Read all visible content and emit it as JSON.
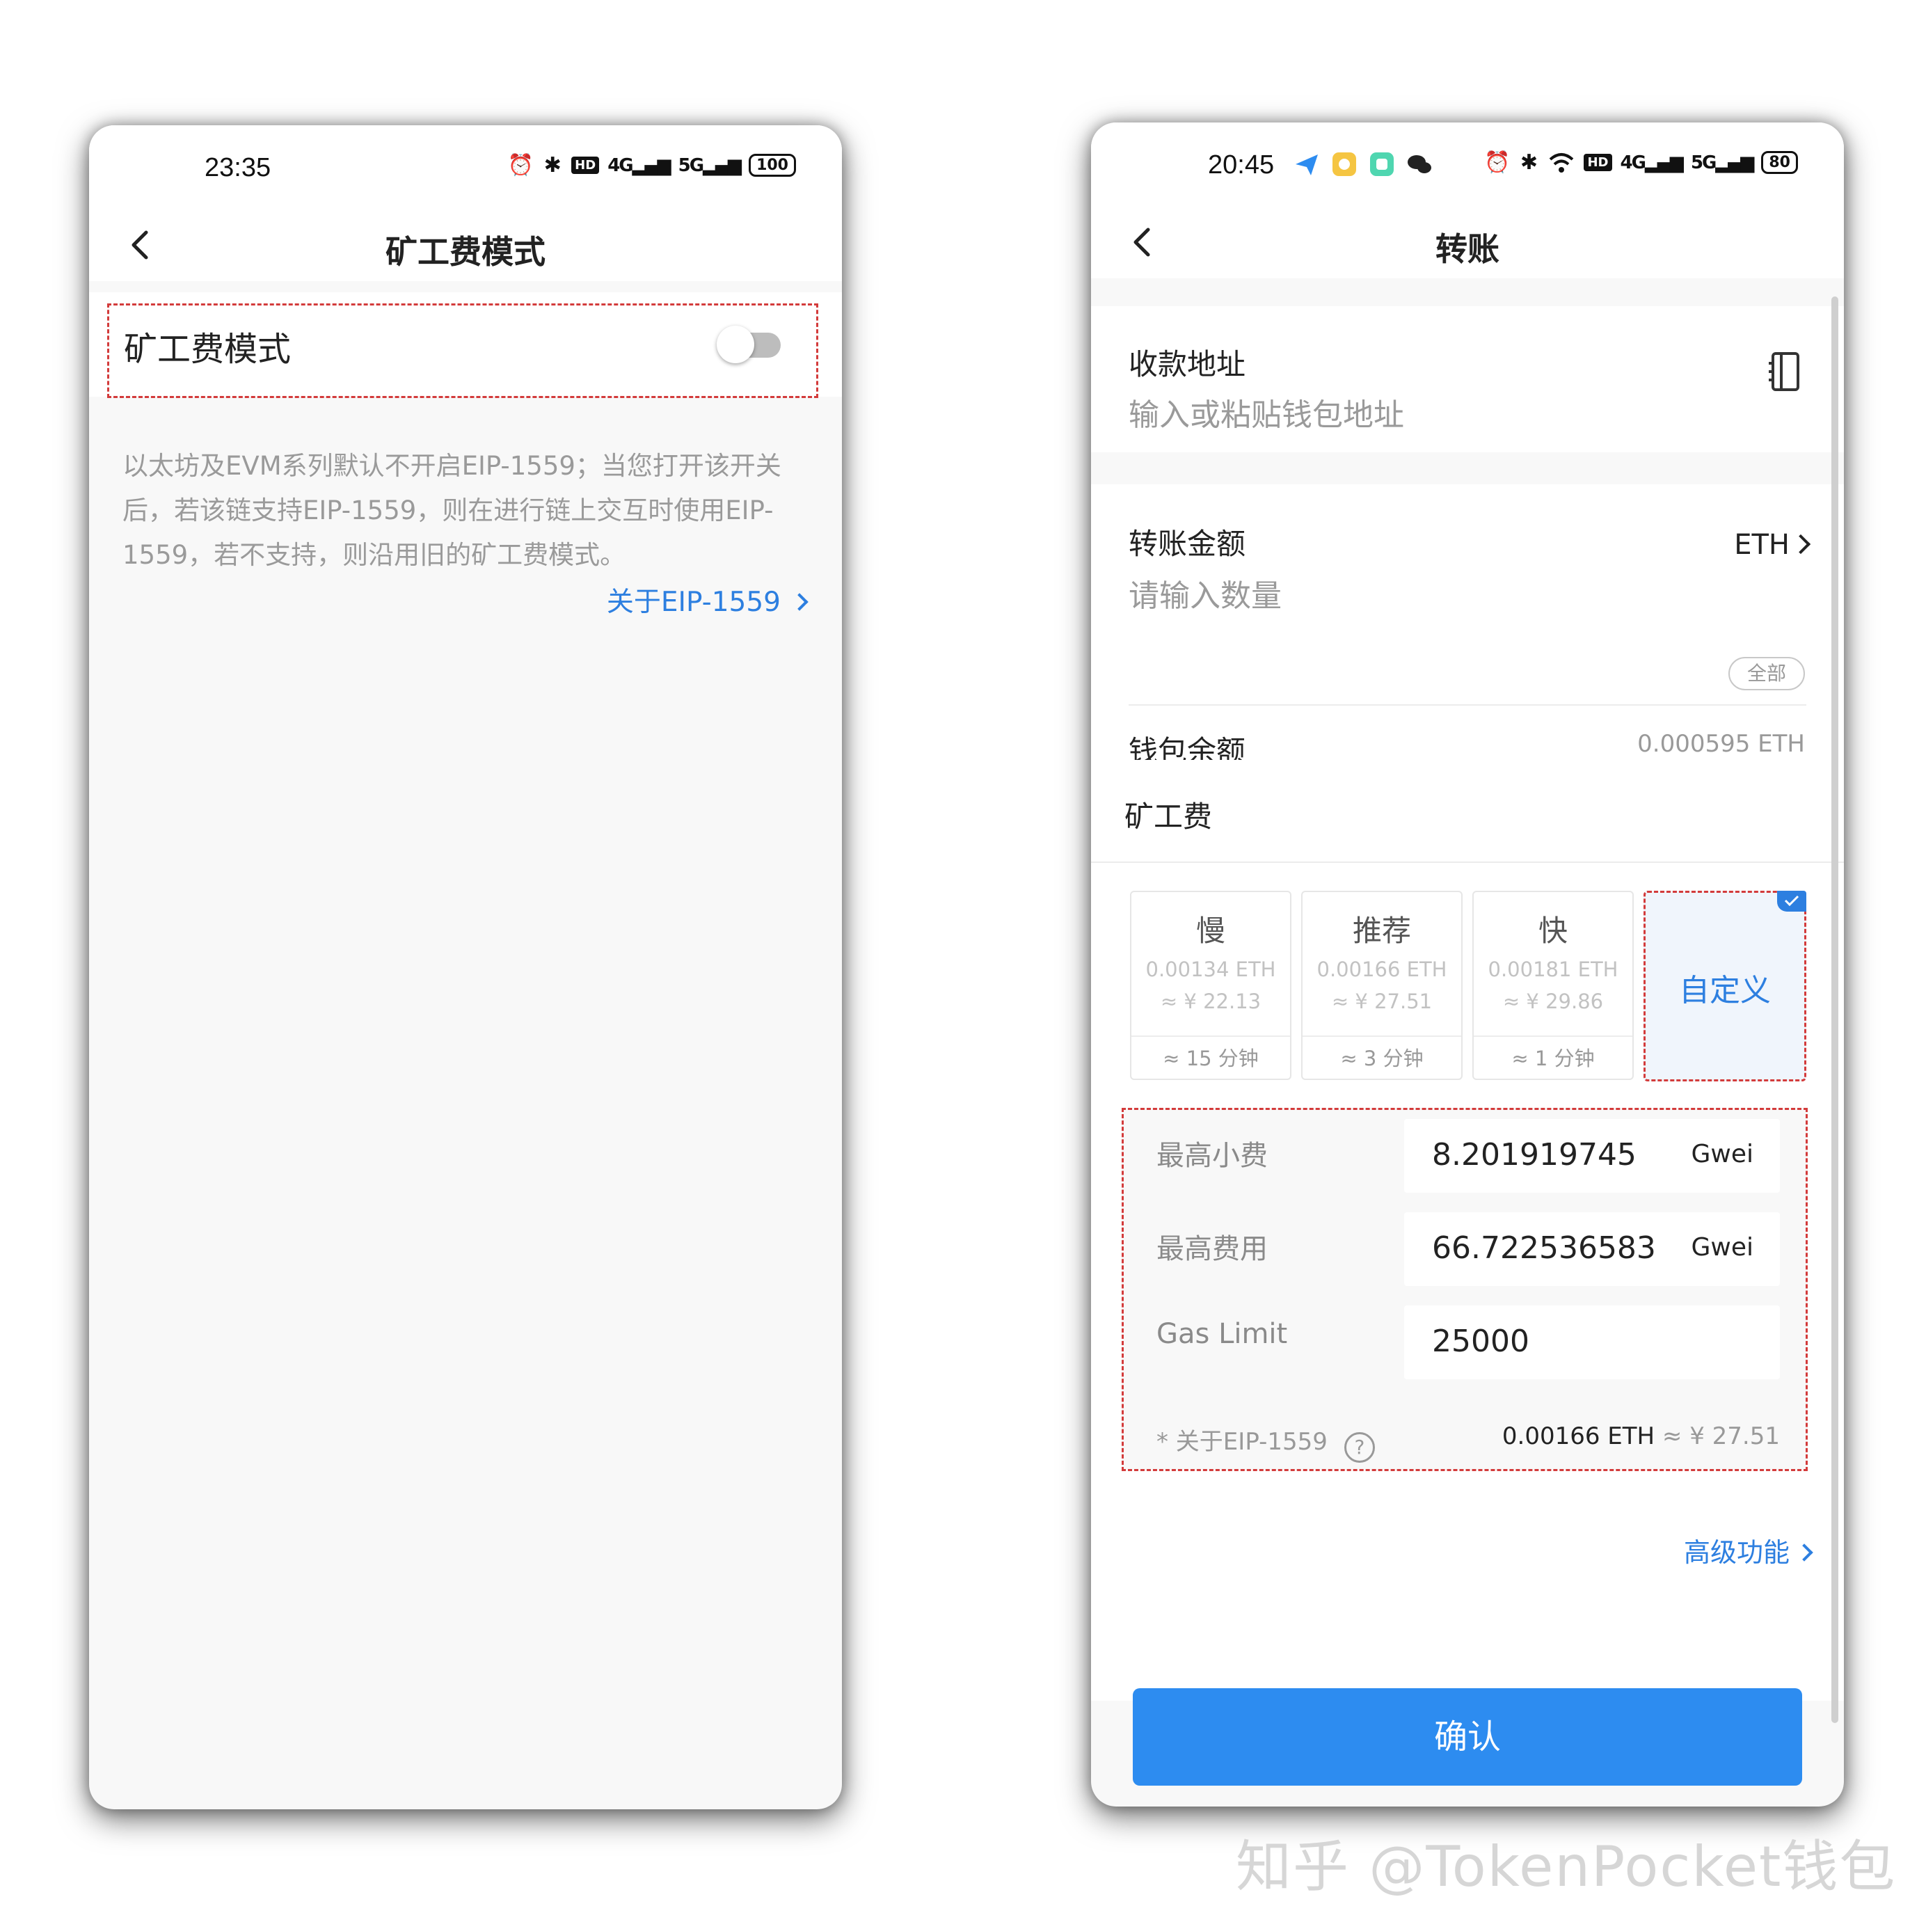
{
  "left_screen": {
    "status": {
      "time": "23:35",
      "icons": [
        "alarm-icon",
        "bluetooth-icon",
        "hd-icon",
        "signal-4g-icon",
        "signal-5g-icon"
      ],
      "hd": "HD",
      "sig1": "4G",
      "sig2": "5G",
      "battery": "100"
    },
    "nav": {
      "title": "矿工费模式"
    },
    "setting": {
      "label": "矿工费模式",
      "enabled": false
    },
    "description": "以太坊及EVM系列默认不开启EIP-1559；当您打开该开关后，若该链支持EIP-1559，则在进行链上交互时使用EIP-1559，若不支持，则沿用旧的矿工费模式。",
    "about_link": "关于EIP-1559"
  },
  "right_screen": {
    "status": {
      "time": "20:45",
      "icons": [
        "alarm-icon",
        "bluetooth-icon",
        "wifi-icon",
        "hd-icon",
        "signal-4g-icon",
        "signal-5g-icon"
      ],
      "hd": "HD",
      "sig1": "4G",
      "sig2": "5G",
      "battery": "80"
    },
    "nav": {
      "title": "转账"
    },
    "address": {
      "label": "收款地址",
      "placeholder": "输入或粘贴钱包地址"
    },
    "amount": {
      "label": "转账金额",
      "unit": "ETH",
      "placeholder": "请输入数量",
      "all_button": "全部"
    },
    "balance": {
      "label": "钱包余额",
      "value": "0.000595 ETH"
    },
    "fee": {
      "title": "矿工费",
      "tiers": [
        {
          "name": "慢",
          "eth": "0.00134 ETH",
          "cny": "≈ ¥ 22.13",
          "time": "≈ 15 分钟"
        },
        {
          "name": "推荐",
          "eth": "0.00166 ETH",
          "cny": "≈ ¥ 27.51",
          "time": "≈ 3 分钟"
        },
        {
          "name": "快",
          "eth": "0.00181 ETH",
          "cny": "≈ ¥ 29.86",
          "time": "≈ 1 分钟"
        }
      ],
      "custom_label": "自定义",
      "selected": "自定义",
      "params": [
        {
          "label": "最高小费",
          "value": "8.201919745",
          "unit": "Gwei"
        },
        {
          "label": "最高费用",
          "value": "66.722536583",
          "unit": "Gwei"
        },
        {
          "label": "Gas Limit",
          "value": "25000",
          "unit": ""
        }
      ],
      "eip_note": "* 关于EIP-1559",
      "total_eth": "0.00166 ETH",
      "total_cny": "≈ ¥ 27.51",
      "advanced_link": "高级功能"
    },
    "confirm_button": "确认"
  },
  "watermark": "知乎 @TokenPocket钱包",
  "colors": {
    "accent": "#2d7fe0",
    "button": "#2d8cf0",
    "highlight_dash": "#d33b3b"
  }
}
